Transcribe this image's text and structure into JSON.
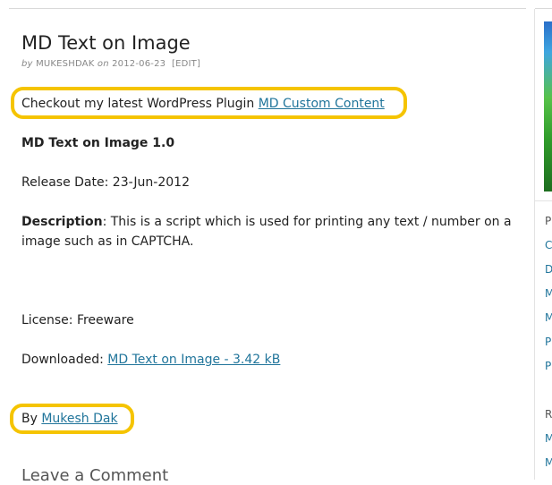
{
  "post": {
    "title": "MD Text on Image",
    "meta": {
      "by": "by",
      "author": "MUKESHDAK",
      "on": "on",
      "date": "2012-06-23",
      "edit": "[EDIT]"
    },
    "plugin_line": {
      "text": "Checkout my latest WordPress Plugin ",
      "link": "MD Custom Content"
    },
    "heading": "MD Text on Image 1.0",
    "release_date": "Release Date: 23-Jun-2012",
    "description": {
      "label": "Description",
      "text": ": This is a script which is used for printing any text / number on a image such as in CAPTCHA."
    },
    "license": "License: Freeware",
    "downloaded": {
      "label": "Downloaded: ",
      "link": "MD Text on Image - 3.42 kB"
    },
    "byline": {
      "label": "By ",
      "link": "Mukesh Dak"
    },
    "leave_comment": "Leave a Comment"
  },
  "sidebar": {
    "letters": [
      "P",
      "C",
      "D",
      "M",
      "M",
      "P",
      "P",
      "R",
      "M",
      "M"
    ]
  },
  "colors": {
    "highlight": "#f5c400",
    "link": "#21759b"
  }
}
